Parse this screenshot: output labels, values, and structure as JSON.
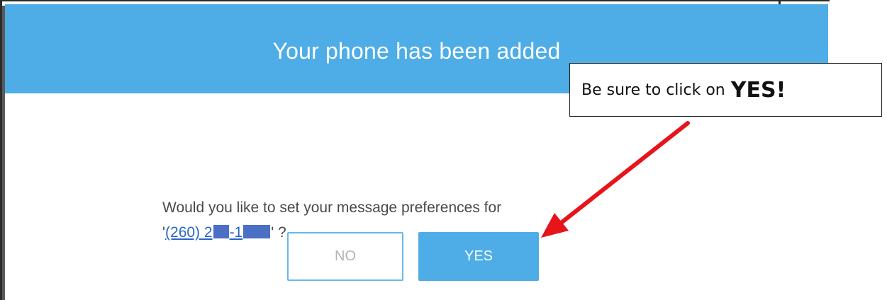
{
  "dialog": {
    "title": "Your phone has been added",
    "message_line1": "Would you like to set your message preferences for",
    "phone_prefix_quote": "'",
    "phone_part1": "(260) 2",
    "phone_part2": "-1",
    "phone_suffix": "' ?",
    "no_label": "NO",
    "yes_label": "YES"
  },
  "annotation": {
    "callout_text": "Be sure to click on",
    "callout_emphasis": "YES!"
  },
  "colors": {
    "header": "#4eade6",
    "link": "#2a66c9",
    "redaction": "#4a6fc4",
    "arrow": "#e8141b"
  },
  "icons": {
    "arrow": "red-arrow-icon"
  }
}
